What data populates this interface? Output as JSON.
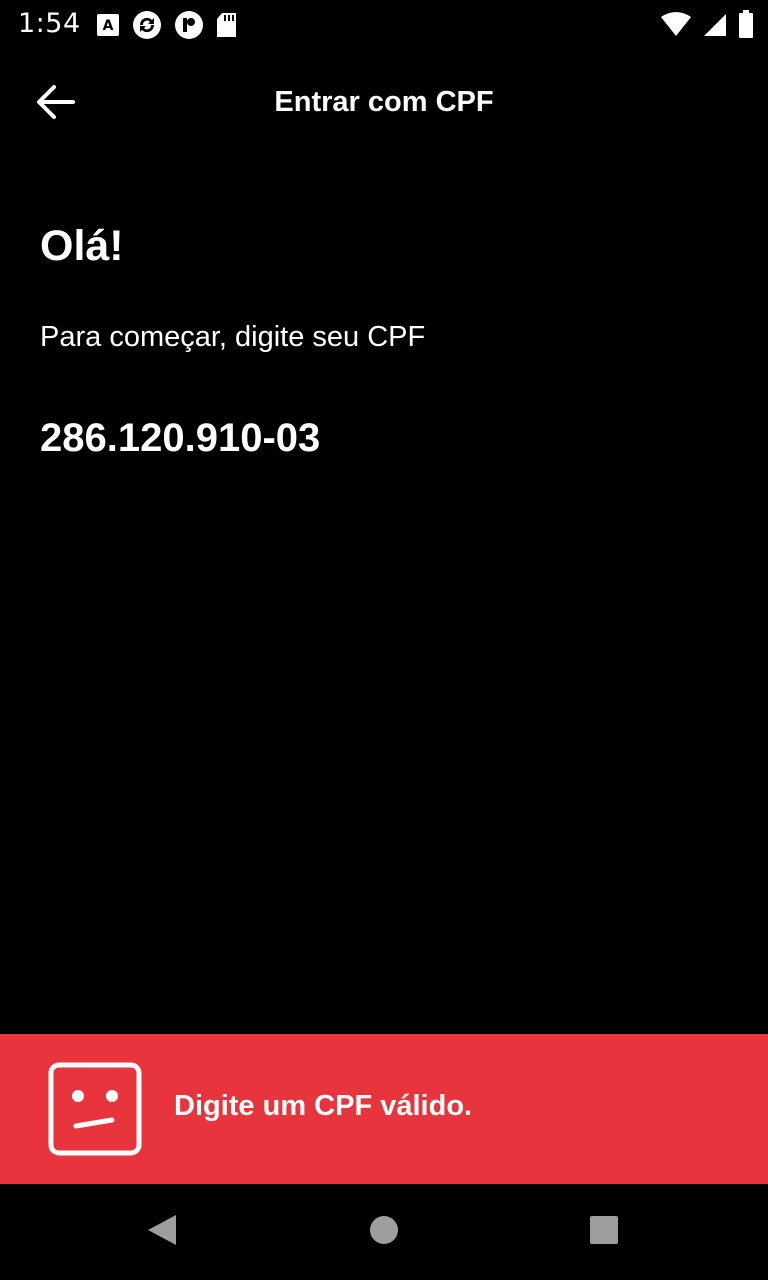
{
  "status_bar": {
    "time": "1:54",
    "left_icons": [
      "a-notification-icon",
      "sync-app-icon",
      "p-app-icon",
      "sd-card-icon"
    ],
    "right_icons": [
      "wifi-icon",
      "signal-icon",
      "battery-icon"
    ]
  },
  "app_bar": {
    "title": "Entrar com CPF",
    "back_icon": "arrow-left-icon"
  },
  "content": {
    "greeting": "Olá!",
    "subtitle": "Para começar, digite seu CPF",
    "cpf_value": "286.120.910-03"
  },
  "error": {
    "message": "Digite um CPF válido.",
    "icon": "sad-face-icon",
    "color": "#e8353d"
  },
  "nav_bar": {
    "buttons": [
      "back-icon",
      "home-icon",
      "recents-icon"
    ]
  },
  "colors": {
    "background": "#000000",
    "text": "#ffffff",
    "error": "#e8353d",
    "nav_icon": "#9e9e9e"
  }
}
